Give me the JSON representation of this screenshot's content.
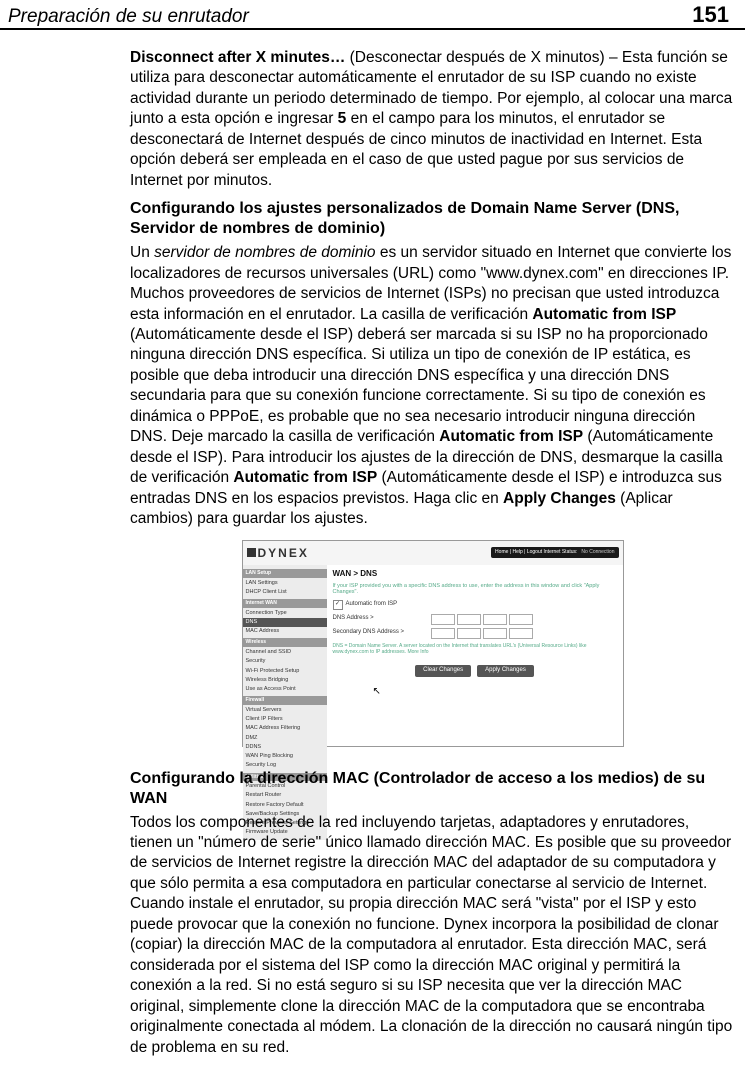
{
  "header": {
    "section": "Preparación de su enrutador",
    "page": "151"
  },
  "p1": {
    "lead_bold": "Disconnect after X minutes…",
    "rest1": " (Desconectar después de X minutos) – Esta función se utiliza para desconectar automáticamente el enrutador de su ISP cuando no existe actividad durante un periodo determinado de tiempo. Por ejemplo, al colocar una marca junto a esta opción e ingresar ",
    "five": "5",
    "rest2": " en el campo para los minutos, el enrutador se desconectará de Internet después de cinco minutos de inactividad en Internet. Esta opción deberá ser empleada en el caso de que usted pague por sus servicios de Internet por minutos."
  },
  "sub1": "Configurando los ajustes personalizados de Domain Name Server (DNS, Servidor de nombres de dominio)",
  "p2": {
    "a": "Un ",
    "italic": "servidor de nombres de dominio",
    "b": " es un servidor situado en Internet que convierte los localizadores de recursos universales (URL) como \"www.dynex.com\" en direcciones IP. Muchos proveedores de servicios de Internet (ISPs) no precisan que usted introduzca esta información en el enrutador. La casilla de verificación ",
    "bold1": "Automatic from ISP",
    "c": " (Automáticamente desde el ISP) deberá ser marcada si su ISP no ha proporcionado ninguna dirección DNS específica. Si utiliza un tipo de conexión de IP estática, es posible que deba introducir una dirección DNS específica y una dirección DNS secundaria para que su conexión funcione correctamente. Si su tipo de conexión es dinámica o PPPoE, es probable que no sea necesario introducir ninguna dirección DNS. Deje marcado la casilla de verificación ",
    "bold2": "Automatic from ISP",
    "d": " (Automáticamente desde el ISP). Para introducir los ajustes de la dirección de DNS, desmarque la casilla de verificación  ",
    "bold3": "Automatic from ISP",
    "e": " (Automáticamente desde el ISP) e introduzca sus entradas DNS en los espacios previstos. Haga clic en ",
    "bold4": "Apply Changes",
    "f": " (Aplicar cambios) para guardar los ajustes."
  },
  "mock": {
    "logo": "DYNEX",
    "nav": {
      "links": "Home | Help | Logout   Internet Status:",
      "status": "No Connection"
    },
    "side": {
      "cat1": "LAN Setup",
      "i1": "LAN Settings",
      "i2": "DHCP Client List",
      "cat2": "Internet WAN",
      "i3": "Connection Type",
      "i4": "DNS",
      "i5": "MAC Address",
      "cat3": "Wireless",
      "i6": "Channel and SSID",
      "i7": "Security",
      "i8": "Wi-Fi Protected Setup",
      "i9": "Wireless Bridging",
      "i10": "Use as Access Point",
      "cat4": "Firewall",
      "i11": "Virtual Servers",
      "i12": "Client IP Filters",
      "i13": "MAC Address Filtering",
      "i14": "DMZ",
      "i15": "DDNS",
      "i16": "WAN Ping Blocking",
      "i17": "Security Log",
      "cat5": "Utilities",
      "i18": "Parental Control",
      "i19": "Restart Router",
      "i20": "Restore Factory Default",
      "i21": "Save/Backup Settings",
      "i22": "Restore Previous Settings",
      "i23": "Firmware Update"
    },
    "main": {
      "title": "WAN > DNS",
      "intro": "If your ISP provided you with a specific DNS address to use, enter the address in this window and click \"Apply Changes\".",
      "check_label": "Automatic from ISP",
      "dns1": "DNS Address >",
      "dns2": "Secondary DNS Address >",
      "footnote": "DNS = Domain Name Server. A server located on the Internet that translates URL's (Universal Resource Links) like www.dynex.com to IP addresses. More Info",
      "btn_clear": "Clear Changes",
      "btn_apply": "Apply Changes"
    }
  },
  "sub2": "Configurando la dirección MAC (Controlador de acceso a los medios) de su WAN",
  "p3": "Todos los componentes de la red incluyendo tarjetas, adaptadores y enrutadores, tienen un \"número de serie\" único llamado dirección MAC. Es posible que su proveedor de servicios de Internet registre la dirección MAC del adaptador de su computadora y que sólo permita a esa computadora en particular conectarse al servicio de Internet. Cuando instale el enrutador, su propia dirección MAC será \"vista\" por el ISP y esto puede provocar que la conexión no funcione. Dynex incorpora la posibilidad de clonar (copiar) la dirección MAC de la computadora al enrutador. Esta dirección MAC, será considerada por el sistema del ISP como la dirección MAC original y permitirá la conexión a la red. Si no está seguro si su ISP necesita que ver la dirección MAC original, simplemente clone la dirección MAC de la computadora que se encontraba originalmente conectada al módem. La clonación de la dirección no causará ningún tipo de problema en su red."
}
